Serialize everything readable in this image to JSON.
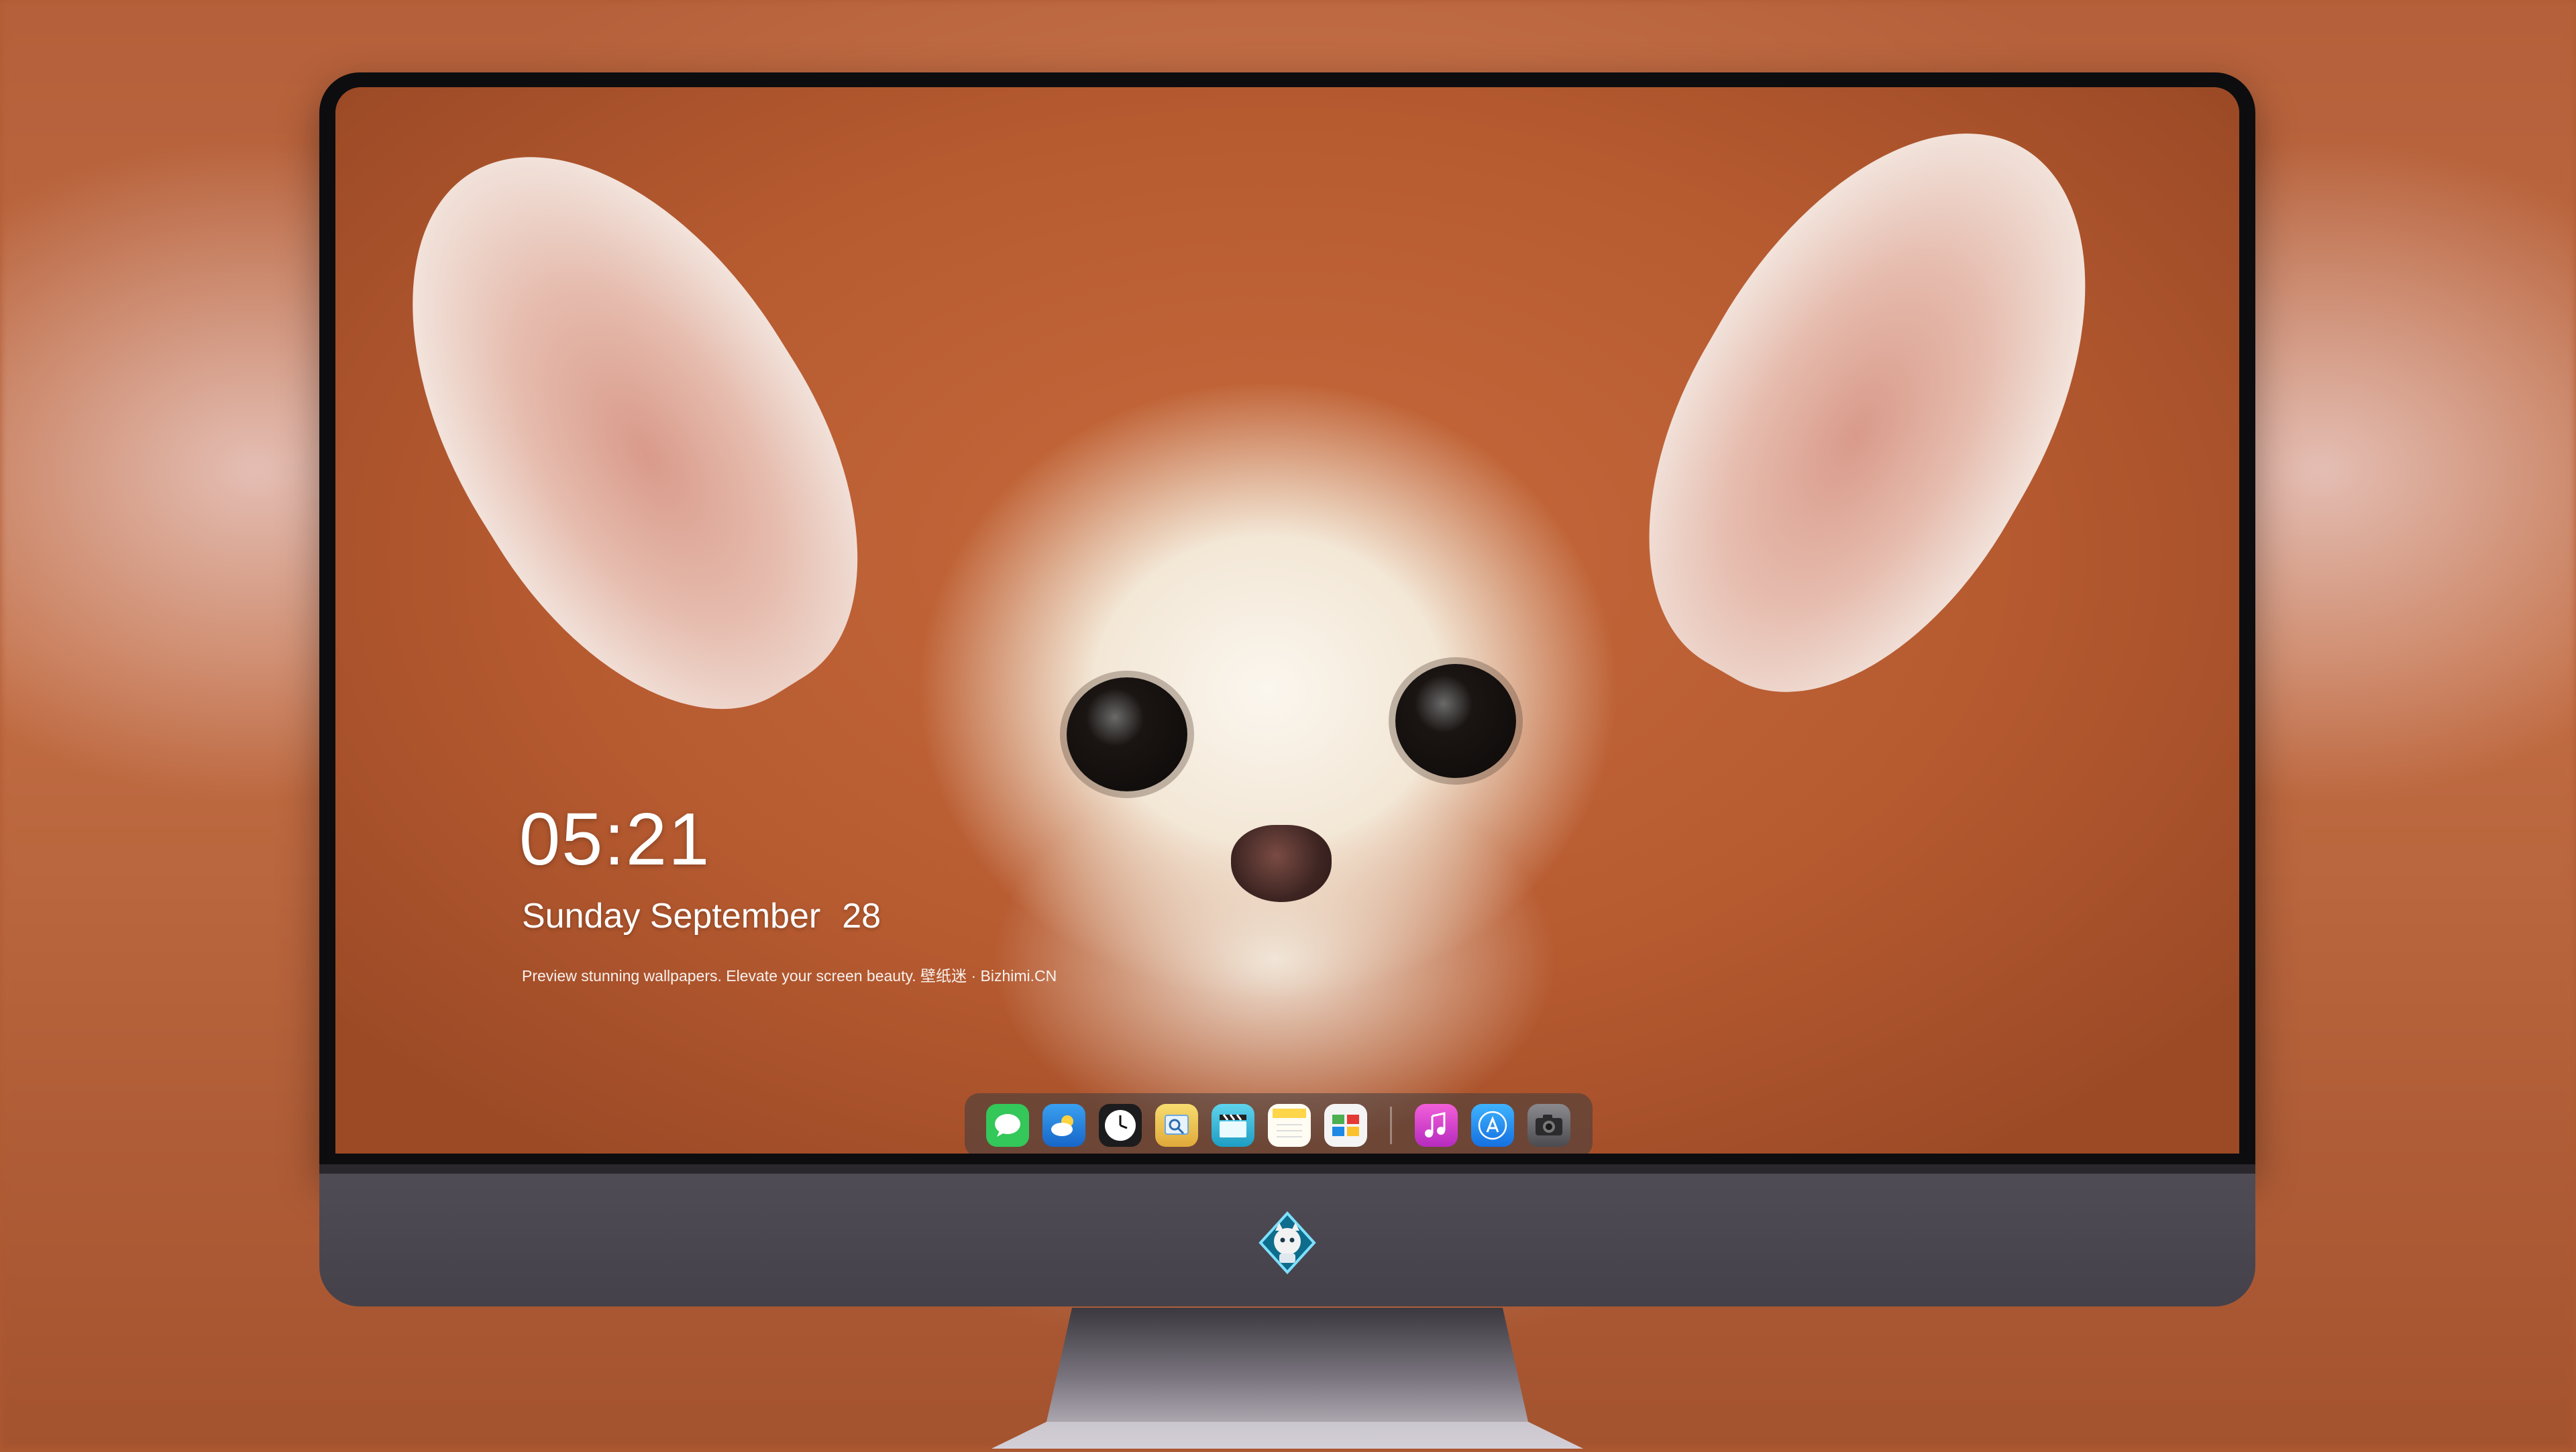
{
  "lockscreen": {
    "time": "05:21",
    "date_weekday_month": "Sunday September",
    "date_day": "28",
    "tagline": "Preview stunning wallpapers. Elevate your screen beauty. 壁纸迷 · Bizhimi.CN"
  },
  "dock": {
    "left_apps": [
      {
        "name": "messages-icon",
        "color": "#34c759"
      },
      {
        "name": "weather-icon",
        "color": "#1e88e5"
      },
      {
        "name": "clock-icon",
        "color": "#1c1c1e"
      },
      {
        "name": "preview-icon",
        "color": "#f2c94c"
      },
      {
        "name": "video-clapper-icon",
        "color": "#29b6d6"
      },
      {
        "name": "notes-icon",
        "color": "#ffd54a"
      },
      {
        "name": "photo-booth-icon",
        "color": "#f4f4f4"
      }
    ],
    "right_apps": [
      {
        "name": "music-icon",
        "color": "#d63fd0"
      },
      {
        "name": "app-store-icon",
        "color": "#1d8ef2"
      },
      {
        "name": "camera-icon",
        "color": "#5a5a5e"
      }
    ]
  },
  "colors": {
    "bezel": "#0d0d0f",
    "chin": "#4b4750",
    "wallpaper_fur": "#b65a30"
  }
}
